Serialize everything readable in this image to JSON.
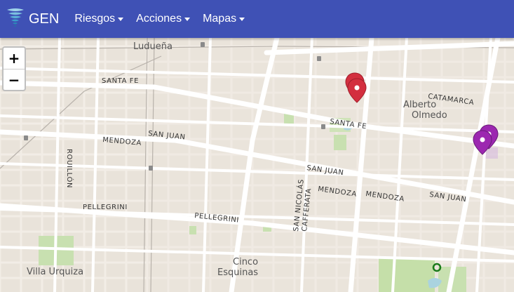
{
  "navbar": {
    "brand": "GEN",
    "brand_icon": "tornado-icon",
    "menu": [
      {
        "label": "Riesgos"
      },
      {
        "label": "Acciones"
      },
      {
        "label": "Mapas"
      }
    ],
    "background": "#3f51b5"
  },
  "map": {
    "zoom_in": "+",
    "zoom_out": "−",
    "street_labels": {
      "santa_fe_w": "SANTA FE",
      "santa_fe_e": "SANTA FE",
      "catamarca": "CATAMARCA",
      "mendoza_w": "MENDOZA",
      "mendoza_c": "MENDOZA",
      "mendoza_e": "MENDOZA",
      "san_juan_w": "SAN JUAN",
      "san_juan_c": "SAN JUAN",
      "san_juan_e": "SAN JUAN",
      "pellegrini_w": "PELLEGRINI",
      "pellegrini_c": "PELLEGRINI",
      "rouillon": "ROUILLÓN",
      "san_nicolas": "SAN NICOLÁS",
      "cafferata": "CAFFERATA"
    },
    "place_labels": {
      "luduena": "Ludueña",
      "alberto_olmedo_1": "Alberto",
      "alberto_olmedo_2": "Olmedo",
      "villa_urquiza": "Villa Urquiza",
      "cinco_esquinas_1": "Cinco",
      "cinco_esquinas_2": "Esquinas"
    },
    "marker_colors": {
      "red": "#d32f3f",
      "purple": "#9c27b0"
    }
  }
}
